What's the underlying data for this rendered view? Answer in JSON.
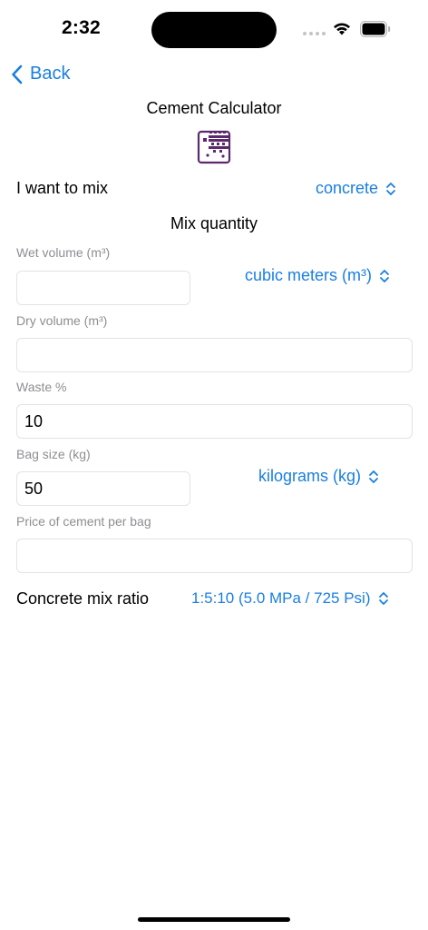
{
  "status": {
    "time": "2:32"
  },
  "nav": {
    "back_label": "Back",
    "title": "Cement Calculator"
  },
  "mix": {
    "label": "I want to mix",
    "value": "concrete"
  },
  "section_title": "Mix quantity",
  "fields": {
    "wet_volume": {
      "label": "Wet volume (m³)",
      "value": ""
    },
    "volume_unit": "cubic meters (m³)",
    "dry_volume": {
      "label": "Dry volume (m³)",
      "value": ""
    },
    "waste": {
      "label": "Waste %",
      "value": "10"
    },
    "bag_size": {
      "label": "Bag size (kg)",
      "value": "50"
    },
    "weight_unit": "kilograms (kg)",
    "price": {
      "label": "Price of cement per bag",
      "value": ""
    }
  },
  "ratio": {
    "label": "Concrete mix ratio",
    "value": "1:5:10 (5.0 MPa / 725 Psi)"
  },
  "colors": {
    "accent": "#1a7fe0",
    "label_gray": "#8e8e93",
    "logo_purple": "#5b2a6e"
  },
  "icons": [
    "chevron-left-icon",
    "up-down-chevron-icon",
    "wifi-icon",
    "battery-icon",
    "cement-logo-icon"
  ]
}
